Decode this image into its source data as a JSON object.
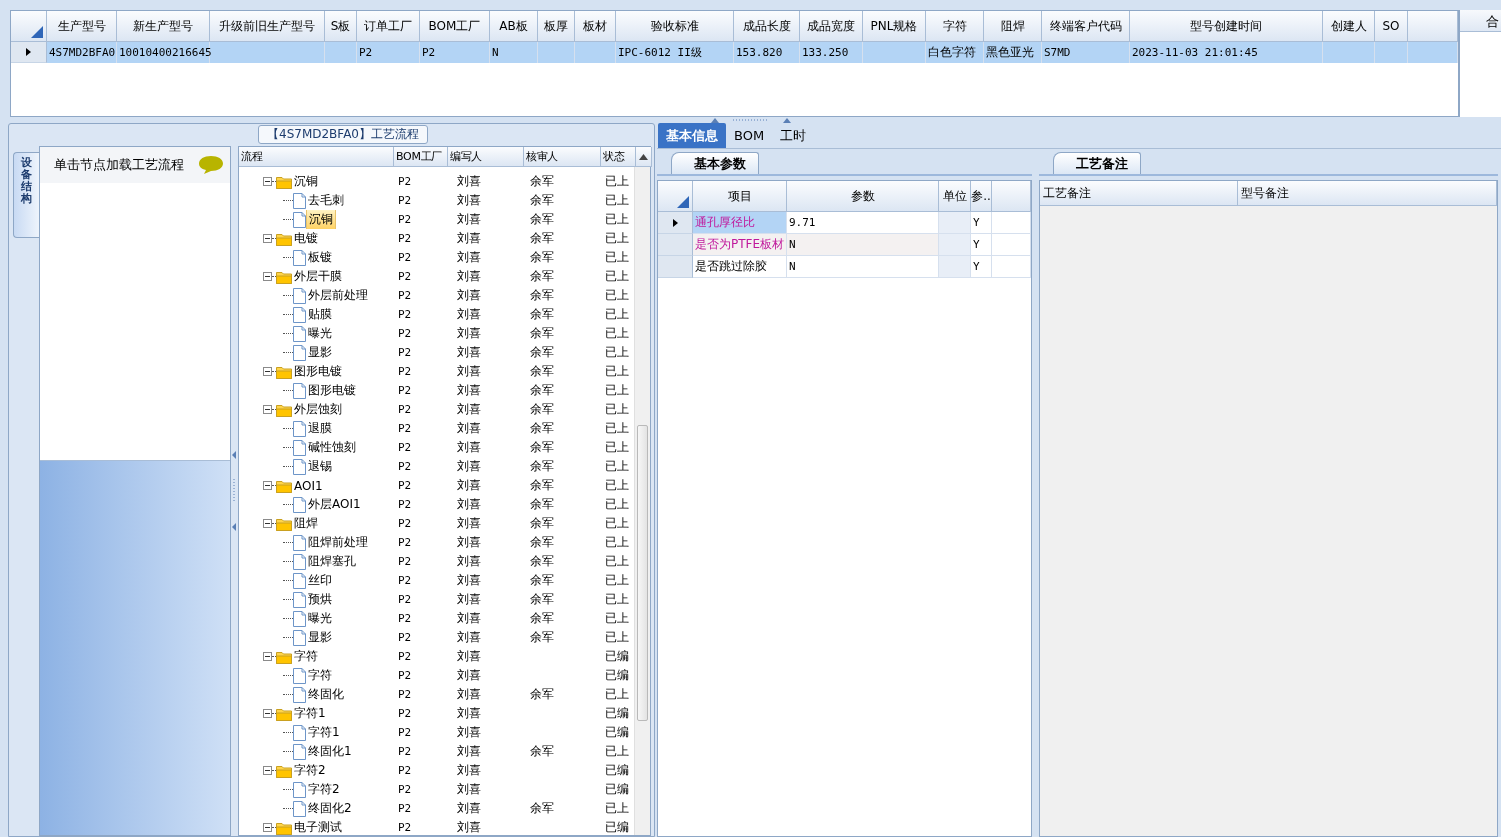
{
  "top_grid": {
    "columns": [
      "生产型号",
      "新生产型号",
      "升级前旧生产型号",
      "S板",
      "订单工厂",
      "BOM工厂",
      "AB板",
      "板厚",
      "板材",
      "验收标准",
      "成品长度",
      "成品宽度",
      "PNL规格",
      "字符",
      "阻焊",
      "终端客户代码",
      "型号创建时间",
      "创建人",
      "SO"
    ],
    "rows": [
      {
        "selected": true,
        "cells": [
          "4S7MD2BFA0",
          "10010400216645",
          "",
          "",
          "P2",
          "P2",
          "N",
          "",
          "",
          "IPC-6012 II级",
          "153.820",
          "133.250",
          "",
          "白色字符",
          "黑色亚光",
          "S7MD",
          "2023-11-03 21:01:45",
          "",
          ""
        ]
      }
    ]
  },
  "side_header": "合",
  "process_panel": {
    "title": "【4S7MD2BFA0】工艺流程",
    "side_tab": "设备结构",
    "list_header": "单击节点加载工艺流程",
    "tree": {
      "columns": [
        "流程",
        "BOM工厂",
        "编写人",
        "核审人",
        "状态"
      ],
      "nodes": [
        {
          "kind": "folder",
          "label": "沉铜",
          "bom": "P2",
          "writer": "刘喜",
          "reviewer": "余军",
          "status": "已上",
          "expanded": true,
          "selected": false,
          "children": [
            {
              "kind": "step",
              "label": "去毛刺",
              "bom": "P2",
              "writer": "刘喜",
              "reviewer": "余军",
              "status": "已上",
              "selected": false
            },
            {
              "kind": "step",
              "label": "沉铜",
              "bom": "P2",
              "writer": "刘喜",
              "reviewer": "余军",
              "status": "已上",
              "selected": true
            }
          ]
        },
        {
          "kind": "folder",
          "label": "电镀",
          "bom": "P2",
          "writer": "刘喜",
          "reviewer": "余军",
          "status": "已上",
          "expanded": true,
          "selected": false,
          "children": [
            {
              "kind": "step",
              "label": "板镀",
              "bom": "P2",
              "writer": "刘喜",
              "reviewer": "余军",
              "status": "已上",
              "selected": false
            }
          ]
        },
        {
          "kind": "folder",
          "label": "外层干膜",
          "bom": "P2",
          "writer": "刘喜",
          "reviewer": "余军",
          "status": "已上",
          "expanded": true,
          "selected": false,
          "children": [
            {
              "kind": "step",
              "label": "外层前处理",
              "bom": "P2",
              "writer": "刘喜",
              "reviewer": "余军",
              "status": "已上",
              "selected": false
            },
            {
              "kind": "step",
              "label": "贴膜",
              "bom": "P2",
              "writer": "刘喜",
              "reviewer": "余军",
              "status": "已上",
              "selected": false
            },
            {
              "kind": "step",
              "label": "曝光",
              "bom": "P2",
              "writer": "刘喜",
              "reviewer": "余军",
              "status": "已上",
              "selected": false
            },
            {
              "kind": "step",
              "label": "显影",
              "bom": "P2",
              "writer": "刘喜",
              "reviewer": "余军",
              "status": "已上",
              "selected": false
            }
          ]
        },
        {
          "kind": "folder",
          "label": "图形电镀",
          "bom": "P2",
          "writer": "刘喜",
          "reviewer": "余军",
          "status": "已上",
          "expanded": true,
          "selected": false,
          "children": [
            {
              "kind": "step",
              "label": "图形电镀",
              "bom": "P2",
              "writer": "刘喜",
              "reviewer": "余军",
              "status": "已上",
              "selected": false
            }
          ]
        },
        {
          "kind": "folder",
          "label": "外层蚀刻",
          "bom": "P2",
          "writer": "刘喜",
          "reviewer": "余军",
          "status": "已上",
          "expanded": true,
          "selected": false,
          "children": [
            {
              "kind": "step",
              "label": "退膜",
              "bom": "P2",
              "writer": "刘喜",
              "reviewer": "余军",
              "status": "已上",
              "selected": false
            },
            {
              "kind": "step",
              "label": "碱性蚀刻",
              "bom": "P2",
              "writer": "刘喜",
              "reviewer": "余军",
              "status": "已上",
              "selected": false
            },
            {
              "kind": "step",
              "label": "退锡",
              "bom": "P2",
              "writer": "刘喜",
              "reviewer": "余军",
              "status": "已上",
              "selected": false
            }
          ]
        },
        {
          "kind": "folder",
          "label": "AOI1",
          "bom": "P2",
          "writer": "刘喜",
          "reviewer": "余军",
          "status": "已上",
          "expanded": true,
          "selected": false,
          "children": [
            {
              "kind": "step",
              "label": "外层AOI1",
              "bom": "P2",
              "writer": "刘喜",
              "reviewer": "余军",
              "status": "已上",
              "selected": false
            }
          ]
        },
        {
          "kind": "folder",
          "label": "阻焊",
          "bom": "P2",
          "writer": "刘喜",
          "reviewer": "余军",
          "status": "已上",
          "expanded": true,
          "selected": false,
          "children": [
            {
              "kind": "step",
              "label": "阻焊前处理",
              "bom": "P2",
              "writer": "刘喜",
              "reviewer": "余军",
              "status": "已上",
              "selected": false
            },
            {
              "kind": "step",
              "label": "阻焊塞孔",
              "bom": "P2",
              "writer": "刘喜",
              "reviewer": "余军",
              "status": "已上",
              "selected": false
            },
            {
              "kind": "step",
              "label": "丝印",
              "bom": "P2",
              "writer": "刘喜",
              "reviewer": "余军",
              "status": "已上",
              "selected": false
            },
            {
              "kind": "step",
              "label": "预烘",
              "bom": "P2",
              "writer": "刘喜",
              "reviewer": "余军",
              "status": "已上",
              "selected": false
            },
            {
              "kind": "step",
              "label": "曝光",
              "bom": "P2",
              "writer": "刘喜",
              "reviewer": "余军",
              "status": "已上",
              "selected": false
            },
            {
              "kind": "step",
              "label": "显影",
              "bom": "P2",
              "writer": "刘喜",
              "reviewer": "余军",
              "status": "已上",
              "selected": false
            }
          ]
        },
        {
          "kind": "folder",
          "label": "字符",
          "bom": "P2",
          "writer": "刘喜",
          "status": "已编",
          "expanded": true,
          "selected": false,
          "children": [
            {
              "kind": "step",
              "label": "字符",
              "bom": "P2",
              "writer": "刘喜",
              "status": "已编",
              "selected": false
            },
            {
              "kind": "step",
              "label": "终固化",
              "bom": "P2",
              "writer": "刘喜",
              "reviewer": "余军",
              "status": "已上",
              "selected": false
            }
          ]
        },
        {
          "kind": "folder",
          "label": "字符1",
          "bom": "P2",
          "writer": "刘喜",
          "status": "已编",
          "expanded": true,
          "selected": false,
          "children": [
            {
              "kind": "step",
              "label": "字符1",
              "bom": "P2",
              "writer": "刘喜",
              "status": "已编",
              "selected": false
            },
            {
              "kind": "step",
              "label": "终固化1",
              "bom": "P2",
              "writer": "刘喜",
              "reviewer": "余军",
              "status": "已上",
              "selected": false
            }
          ]
        },
        {
          "kind": "folder",
          "label": "字符2",
          "bom": "P2",
          "writer": "刘喜",
          "status": "已编",
          "expanded": true,
          "selected": false,
          "children": [
            {
              "kind": "step",
              "label": "字符2",
              "bom": "P2",
              "writer": "刘喜",
              "status": "已编",
              "selected": false
            },
            {
              "kind": "step",
              "label": "终固化2",
              "bom": "P2",
              "writer": "刘喜",
              "reviewer": "余军",
              "status": "已上",
              "selected": false
            }
          ]
        },
        {
          "kind": "folder",
          "label": "电子测试",
          "bom": "P2",
          "writer": "刘喜",
          "status": "已编",
          "expanded": true,
          "selected": false
        }
      ]
    }
  },
  "info_panel": {
    "tabs": [
      {
        "label": "基本信息",
        "selected": true
      },
      {
        "label": "BOM",
        "selected": false
      },
      {
        "label": "工时",
        "selected": false
      }
    ],
    "params": {
      "tab": "基本参数",
      "columns": [
        "项目",
        "参数",
        "单位",
        "参.."
      ],
      "rows": [
        {
          "item": "通孔厚径比",
          "highlighted": true,
          "value": "9.71",
          "flag": "Y",
          "selected": true
        },
        {
          "item": "是否为PTFE板材",
          "highlighted": true,
          "value": "N",
          "flag": "Y",
          "selected": false
        },
        {
          "item": "是否跳过除胶",
          "highlighted": false,
          "value": "N",
          "flag": "Y",
          "selected": false
        }
      ]
    },
    "notes": {
      "tab": "工艺备注",
      "columns": [
        "工艺备注",
        "型号备注"
      ]
    }
  }
}
